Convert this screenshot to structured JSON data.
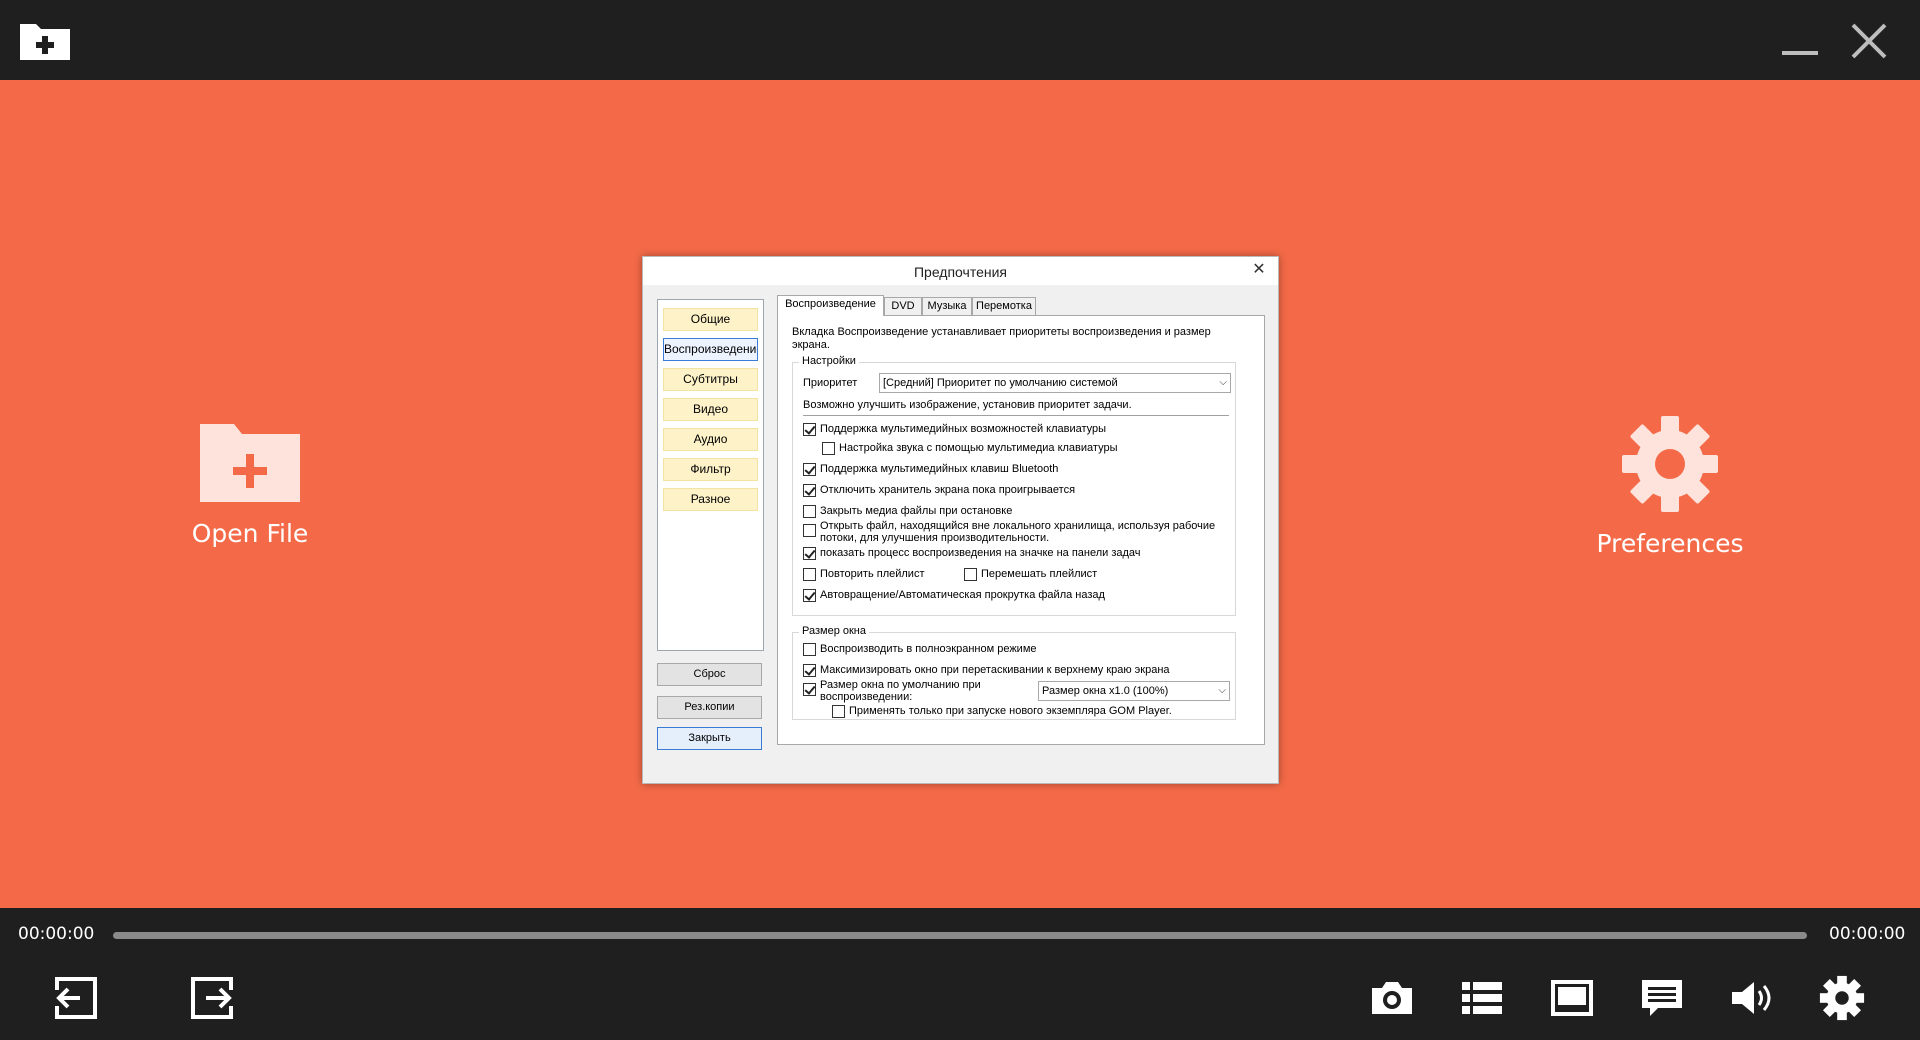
{
  "app": {
    "colors": {
      "accent": "#f46a48",
      "bar": "#1f1f1f",
      "icon": "#ffffff",
      "dialog_bg": "#f0f0f0",
      "nav_item_bg": "#fdf2c8",
      "focus_border": "#3b7ad6"
    },
    "top_icons": {
      "open": "folder-plus-icon",
      "minimize": "minimize-icon",
      "close": "close-icon"
    }
  },
  "stage": {
    "open_file_label": "Open File",
    "preferences_label": "Preferences"
  },
  "dialog": {
    "title": "Предпочтения",
    "nav": [
      "Общие",
      "Воспроизведение",
      "Субтитры",
      "Видео",
      "Аудио",
      "Фильтр",
      "Разное"
    ],
    "buttons": {
      "reset": "Сброс",
      "backup": "Рез.копии",
      "close": "Закрыть"
    },
    "tabs": [
      "Воспроизведение",
      "DVD",
      "Музыка",
      "Перемотка"
    ],
    "description": "Вкладка Воспроизведение устанавливает приоритеты воспроизведения и размер экрана.",
    "settings": {
      "title": "Настройки",
      "priority_label": "Приоритет",
      "priority_value": "[Средний] Приоритет по умолчанию системой",
      "priority_hint": "Возможно улучшить изображение, установив приоритет задачи.",
      "checkboxes": [
        {
          "label": "Поддержка мультимедийных возможностей клавиатуры",
          "checked": true
        },
        {
          "label": "Настройка звука с помощью мультимедиа клавиатуры",
          "checked": false
        },
        {
          "label": "Поддержка мультимедийных клавиш Bluetooth",
          "checked": true
        },
        {
          "label": "Отключить хранитель экрана пока проигрывается",
          "checked": true
        },
        {
          "label": "Закрыть медиа файлы при остановке",
          "checked": false
        },
        {
          "label": "Открыть файл, находящийся вне локального хранилища, используя рабочие потоки, для улучшения производительности.",
          "checked": false
        },
        {
          "label": "показать процесс воспроизведения на значке на панели задач",
          "checked": true
        },
        {
          "label": "Повторить плейлист",
          "checked": false
        },
        {
          "label": "Перемешать плейлист",
          "checked": false
        },
        {
          "label": "Автовращение/Автоматическая прокрутка файла назад",
          "checked": true
        }
      ]
    },
    "window_size": {
      "title": "Размер окна",
      "checkboxes": [
        {
          "label": "Воспроизводить в полноэкранном режиме",
          "checked": false
        },
        {
          "label": "Максимизировать окно при перетаскивании к верхнему краю экрана",
          "checked": true
        },
        {
          "label": "Размер окна по умолчанию при воспроизведении:",
          "checked": true
        },
        {
          "label": "Применять только при запуске нового экземпляра GOM Player.",
          "checked": false
        }
      ],
      "size_value": "Размер окна x1.0 (100%)"
    }
  },
  "player": {
    "time_current": "00:00:00",
    "time_total": "00:00:00",
    "progress": 0,
    "controls_left": [
      "previous-file-icon",
      "next-file-icon"
    ],
    "controls_right": [
      "screenshot-icon",
      "playlist-icon",
      "screen-ratio-icon",
      "subtitles-icon",
      "volume-icon",
      "settings-icon"
    ]
  }
}
